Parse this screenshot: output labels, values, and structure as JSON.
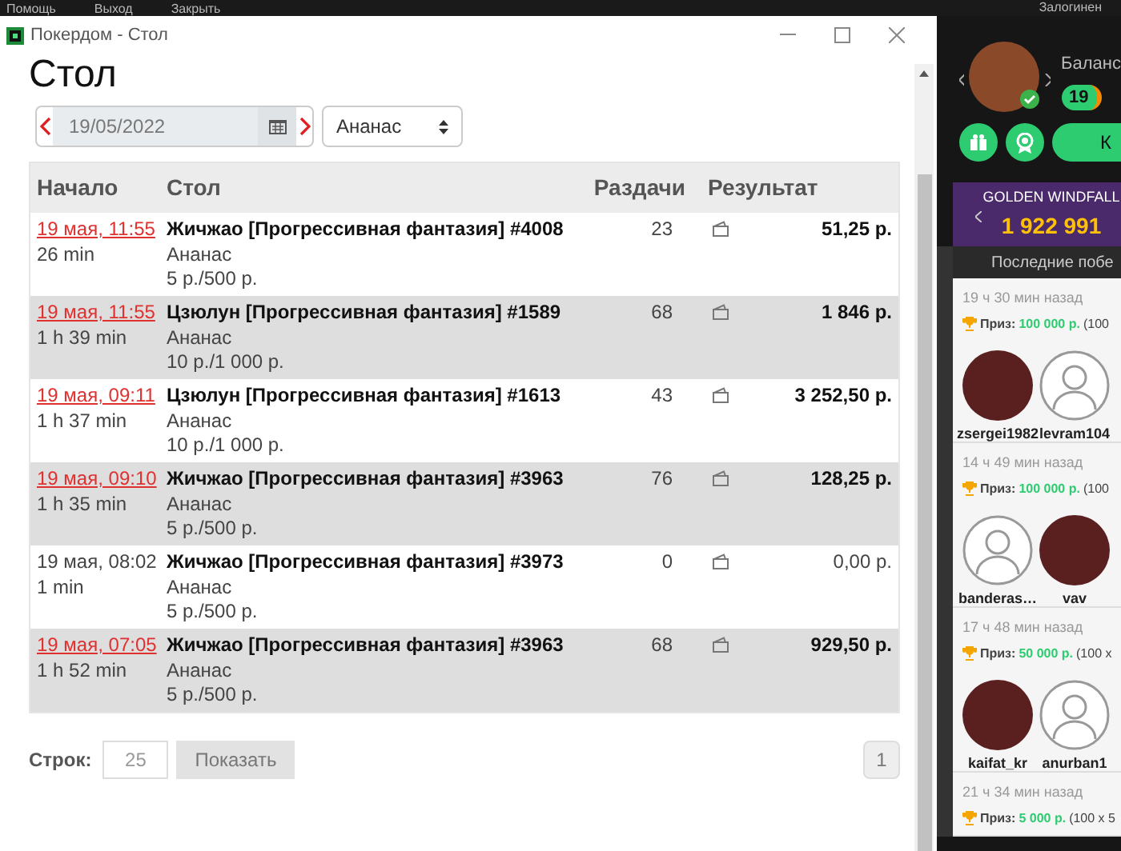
{
  "top_menu": [
    "Помощь",
    "Выход",
    "Закрыть"
  ],
  "top_right": "Залогинен",
  "window": {
    "title": "Покердом - Стол"
  },
  "page_title": "Стол",
  "date_field": {
    "value": "19/05/2022"
  },
  "filter_select": {
    "value": "Ананас"
  },
  "table": {
    "columns": [
      "Начало",
      "Стол",
      "Раздачи",
      "Результат"
    ],
    "rows": [
      {
        "start": "19 мая, 11:55",
        "link": true,
        "duration": "26 min",
        "table": "Жичжао [Прогрессивная фантазия] #4008",
        "player": "Ананас",
        "stakes": "5 р./500 р.",
        "hands": "23",
        "result": "51,25 р.",
        "bold": true
      },
      {
        "start": "19 мая, 11:55",
        "link": true,
        "duration": "1 h 39 min",
        "table": "Цзюлун [Прогрессивная фантазия] #1589",
        "player": "Ананас",
        "stakes": "10 р./1 000 р.",
        "hands": "68",
        "result": "1 846 р.",
        "bold": true
      },
      {
        "start": "19 мая, 09:11",
        "link": true,
        "duration": "1 h 37 min",
        "table": "Цзюлун [Прогрессивная фантазия] #1613",
        "player": "Ананас",
        "stakes": "10 р./1 000 р.",
        "hands": "43",
        "result": "3 252,50 р.",
        "bold": true
      },
      {
        "start": "19 мая, 09:10",
        "link": true,
        "duration": "1 h 35 min",
        "table": "Жичжао [Прогрессивная фантазия] #3963",
        "player": "Ананас",
        "stakes": "5 р./500 р.",
        "hands": "76",
        "result": "128,25 р.",
        "bold": true
      },
      {
        "start": "19 мая, 08:02",
        "link": false,
        "duration": "1 min",
        "table": "Жичжао [Прогрессивная фантазия] #3973",
        "player": "Ананас",
        "stakes": "5 р./500 р.",
        "hands": "0",
        "result": "0,00 р.",
        "bold": false
      },
      {
        "start": "19 мая, 07:05",
        "link": true,
        "duration": "1 h 52 min",
        "table": "Жичжао [Прогрессивная фантазия] #3963",
        "player": "Ананас",
        "stakes": "5 р./500 р.",
        "hands": "68",
        "result": "929,50 р.",
        "bold": true
      }
    ]
  },
  "pager": {
    "rows_label": "Строк:",
    "rows_value": "25",
    "show_button": "Показать",
    "page": "1"
  },
  "side": {
    "balance_label": "Баланс",
    "level": "19",
    "action_button": "К",
    "jackpot_title": "GOLDEN WINDFALL",
    "jackpot_amount": "1 922 991",
    "winners_header": "Последние побе",
    "winners": [
      {
        "time": "19 ч 30 мин назад",
        "prize_label": "Приз:",
        "prize": "100 000 р.",
        "prize_extra": "(100",
        "players": [
          {
            "name": "zsergei1982",
            "photo": true
          },
          {
            "name": "levram104",
            "photo": false
          }
        ]
      },
      {
        "time": "14 ч 49 мин назад",
        "prize_label": "Приз:",
        "prize": "100 000 р.",
        "prize_extra": "(100",
        "players": [
          {
            "name": "banderas…",
            "photo": false
          },
          {
            "name": "vav",
            "photo": true
          }
        ]
      },
      {
        "time": "17 ч 48 мин назад",
        "prize_label": "Приз:",
        "prize": "50 000 р.",
        "prize_extra": "(100 x",
        "players": [
          {
            "name": "kaifat_kr",
            "photo": true
          },
          {
            "name": "anurban1",
            "photo": false
          }
        ]
      },
      {
        "time": "21 ч 34 мин назад",
        "prize_label": "Приз:",
        "prize": "5 000 р.",
        "prize_extra": "(100 x 5"
      }
    ]
  }
}
